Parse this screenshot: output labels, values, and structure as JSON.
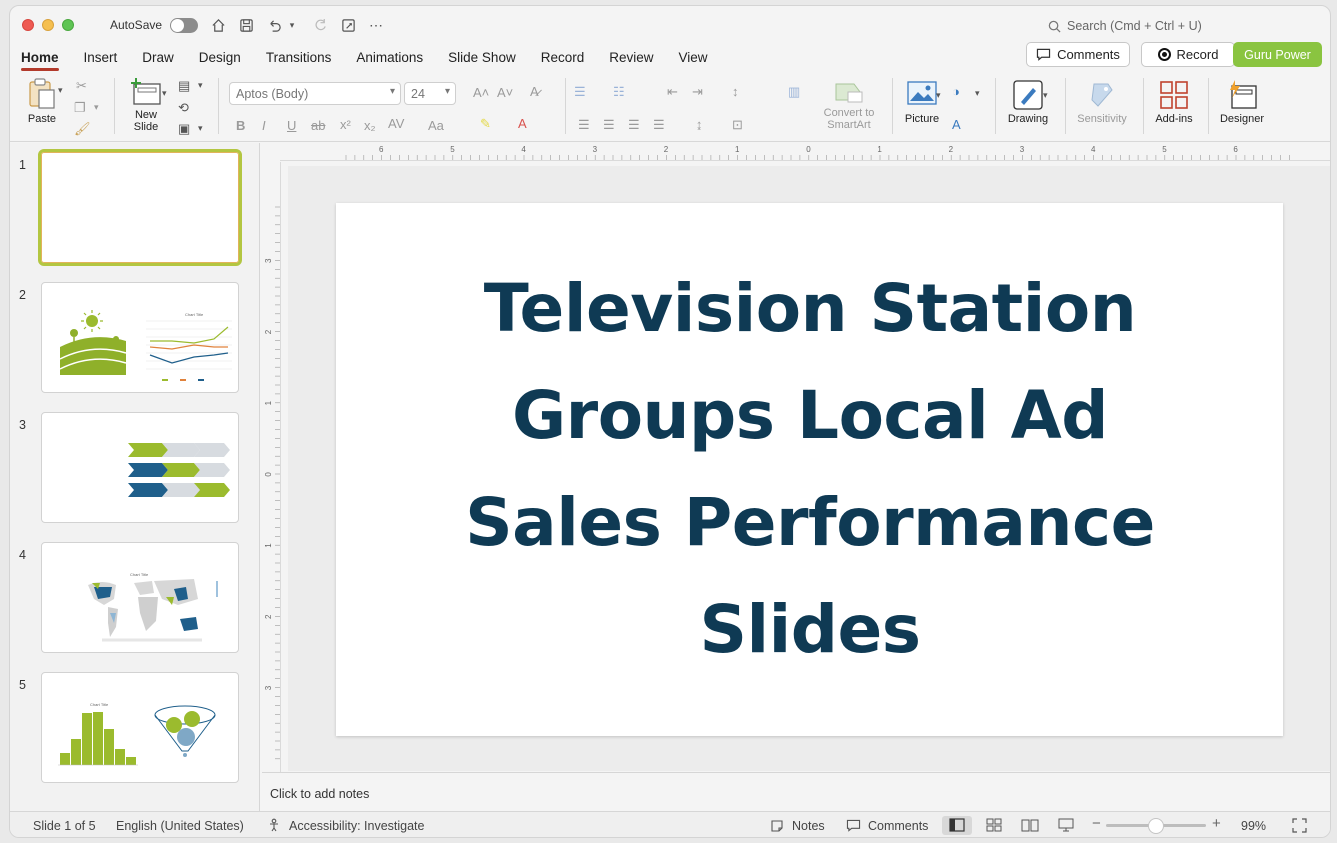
{
  "titlebar": {
    "autosave_label": "AutoSave",
    "search_placeholder": "Search (Cmd + Ctrl + U)"
  },
  "tabs": [
    "Home",
    "Insert",
    "Draw",
    "Design",
    "Transitions",
    "Animations",
    "Slide Show",
    "Record",
    "Review",
    "View"
  ],
  "actions": {
    "comments": "Comments",
    "record": "Record",
    "guru": "Guru Power"
  },
  "ribbon": {
    "paste": "Paste",
    "new_slide_1": "New",
    "new_slide_2": "Slide",
    "font_name": "Aptos (Body)",
    "font_size": "24",
    "convert_1": "Convert to",
    "convert_2": "SmartArt",
    "picture": "Picture",
    "drawing": "Drawing",
    "sensitivity": "Sensitivity",
    "addins": "Add-ins",
    "designer": "Designer"
  },
  "thumbnails": [
    "1",
    "2",
    "3",
    "4",
    "5"
  ],
  "thumb_texts": {
    "chart_title": "Chart Title"
  },
  "ruler": {
    "h_ticks": [
      "6",
      "5",
      "4",
      "3",
      "2",
      "1",
      "0",
      "1",
      "2",
      "3",
      "4",
      "5",
      "6"
    ],
    "v_ticks": [
      "3",
      "2",
      "1",
      "0",
      "1",
      "2",
      "3"
    ]
  },
  "slide": {
    "title_lines": [
      "Television Station",
      "Groups Local Ad",
      "Sales Performance",
      "Slides"
    ]
  },
  "notes_placeholder": "Click to add notes",
  "status": {
    "slide_info": "Slide 1 of 5",
    "language": "English (United States)",
    "accessibility": "Accessibility: Investigate",
    "notes": "Notes",
    "comments": "Comments",
    "zoom": "99%"
  },
  "colors": {
    "title": "#0f3a54",
    "accent_green": "#8ac440",
    "tab_underline": "#b23a2b"
  }
}
